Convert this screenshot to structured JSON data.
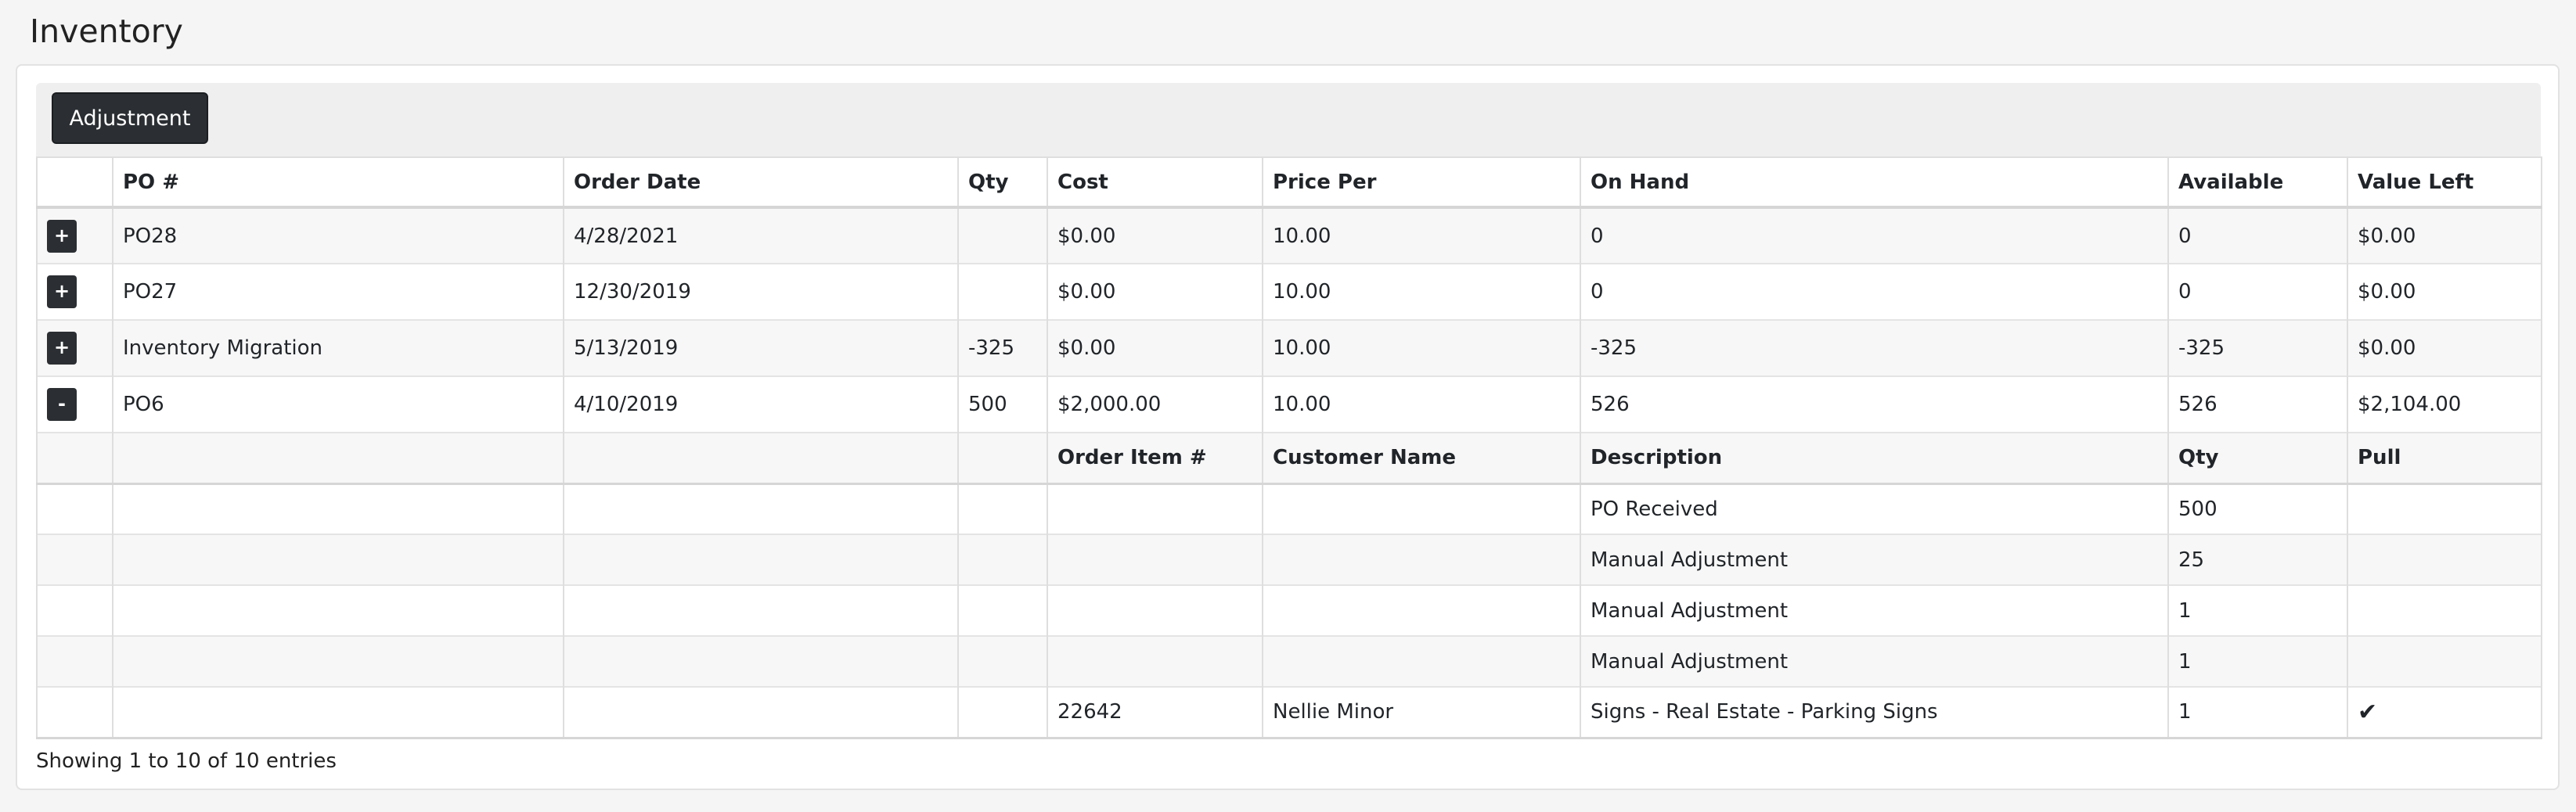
{
  "page": {
    "title": "Inventory"
  },
  "toolbar": {
    "adjustment_label": "Adjustment"
  },
  "table": {
    "columns": [
      "",
      "PO #",
      "Order Date",
      "Qty",
      "Cost",
      "Price Per",
      "On Hand",
      "Available",
      "Value Left"
    ],
    "rows": [
      {
        "toggle": "+",
        "po": "PO28",
        "order_date": "4/28/2021",
        "qty": "",
        "cost": "$0.00",
        "price_per": "10.00",
        "on_hand": "0",
        "available": "0",
        "value_left": "$0.00"
      },
      {
        "toggle": "+",
        "po": "PO27",
        "order_date": "12/30/2019",
        "qty": "",
        "cost": "$0.00",
        "price_per": "10.00",
        "on_hand": "0",
        "available": "0",
        "value_left": "$0.00"
      },
      {
        "toggle": "+",
        "po": "Inventory Migration",
        "order_date": "5/13/2019",
        "qty": "-325",
        "cost": "$0.00",
        "price_per": "10.00",
        "on_hand": "-325",
        "available": "-325",
        "value_left": "$0.00"
      },
      {
        "toggle": "-",
        "po": "PO6",
        "order_date": "4/10/2019",
        "qty": "500",
        "cost": "$2,000.00",
        "price_per": "10.00",
        "on_hand": "526",
        "available": "526",
        "value_left": "$2,104.00"
      }
    ],
    "detail_columns": [
      "Order Item #",
      "Customer Name",
      "Description",
      "Qty",
      "Pull"
    ],
    "detail_rows": [
      {
        "order_item": "",
        "customer": "",
        "description": "PO Received",
        "qty": "500",
        "pull": ""
      },
      {
        "order_item": "",
        "customer": "",
        "description": "Manual Adjustment",
        "qty": "25",
        "pull": ""
      },
      {
        "order_item": "",
        "customer": "",
        "description": "Manual Adjustment",
        "qty": "1",
        "pull": ""
      },
      {
        "order_item": "",
        "customer": "",
        "description": "Manual Adjustment",
        "qty": "1",
        "pull": ""
      },
      {
        "order_item": "22642",
        "customer": "Nellie Minor",
        "description": "Signs - Real Estate - Parking Signs",
        "qty": "1",
        "pull": "✔"
      }
    ]
  },
  "footer": {
    "info": "Showing 1 to 10 of 10 entries"
  }
}
